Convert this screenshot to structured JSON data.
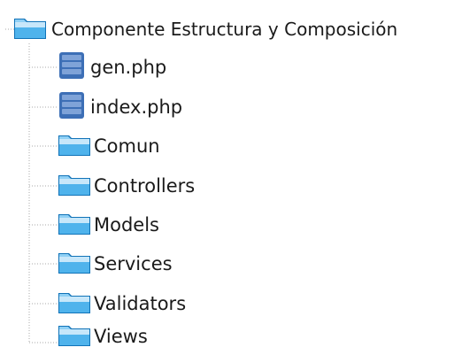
{
  "tree": {
    "root": {
      "label": "Componente Estructura y Composición",
      "icon": "folder-icon"
    },
    "children": [
      {
        "label": "gen.php",
        "icon": "php-file-icon",
        "kind": "file"
      },
      {
        "label": "index.php",
        "icon": "php-file-icon",
        "kind": "file"
      },
      {
        "label": "Comun",
        "icon": "folder-icon",
        "kind": "folder"
      },
      {
        "label": "Controllers",
        "icon": "folder-icon",
        "kind": "folder"
      },
      {
        "label": "Models",
        "icon": "folder-icon",
        "kind": "folder"
      },
      {
        "label": "Services",
        "icon": "folder-icon",
        "kind": "folder"
      },
      {
        "label": "Validators",
        "icon": "folder-icon",
        "kind": "folder"
      },
      {
        "label": "Views",
        "icon": "folder-icon",
        "kind": "folder"
      }
    ]
  },
  "colors": {
    "folder_light": "#c7e7fa",
    "folder_mid": "#4fb3ec",
    "folder_dark": "#1173b8",
    "file_blue": "#3d6fb6",
    "tree_line": "#a8a8a8",
    "text": "#1a1a1a"
  }
}
